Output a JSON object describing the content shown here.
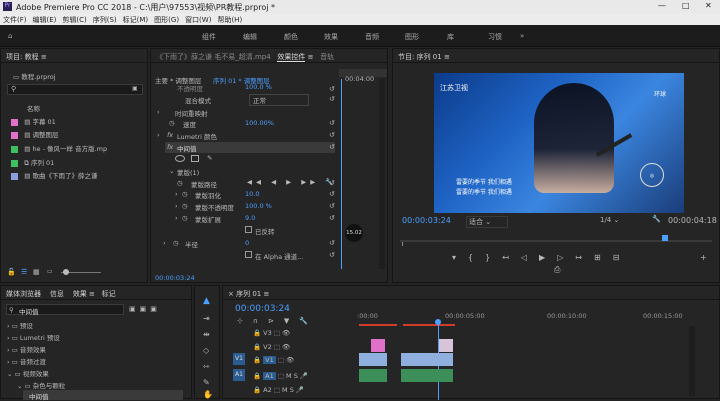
{
  "app_title": "Adobe Premiere Pro CC 2018 - C:\\用户\\97553\\视频\\PR教程.prproj *",
  "window_controls": [
    "—",
    "□",
    "✕"
  ],
  "menu": [
    "文件(F)",
    "编辑(E)",
    "剪辑(C)",
    "序列(S)",
    "标记(M)",
    "图形(G)",
    "窗口(W)",
    "帮助(H)"
  ],
  "workspaces": [
    "组件",
    "编辑",
    "颜色",
    "效果",
    "音频",
    "图形",
    "库",
    "习惯"
  ],
  "project": {
    "title": "项目: 教程",
    "file": "教程.prproj",
    "col_name": "名称",
    "items": [
      {
        "name": "字幕 01",
        "color": "#e070c8"
      },
      {
        "name": "调整图层",
        "color": "#e070c8"
      },
      {
        "name": "he - 像风一样 音方版.mp",
        "color": "#3fbf5f"
      },
      {
        "name": "序列 01",
        "color": "#3fbf5f"
      },
      {
        "name": "歌曲《下雨了》薛之谦",
        "color": "#8a9fe0"
      }
    ]
  },
  "effect_controls": {
    "tabs": [
      "《下雨了》薛之谦 毛不易_超清.mp4",
      "效果控件",
      "音轨"
    ],
    "master": "主要 * 调整图层",
    "seq": "序列 01 * 调整图层",
    "timecode": "00:04:00",
    "rows": {
      "blend_label": "混合模式",
      "blend_val": "正常",
      "opacity_partial": "不透明度",
      "opacity_val": "100.0 %",
      "time_remap": "时间重映射",
      "speed_label": "速度",
      "speed_val": "100.00%",
      "lumetri": "Lumetri 颜色",
      "median": "中间值",
      "mask": "蒙版(1)",
      "mask_path": "蒙版路径",
      "mask_feather": "蒙版羽化",
      "feather_val": "10.0",
      "mask_opacity": "蒙版不透明度",
      "mask_opacity_val": "100.0 %",
      "mask_expand": "蒙版扩展",
      "expand_val": "9.0",
      "invert": "已反转",
      "radius": "半径",
      "radius_val": "0",
      "alpha": "在 Alpha 通道...",
      "footer_tc": "00:00:03:24",
      "tooltip": "15.02"
    }
  },
  "program": {
    "title": "节目: 序列 01",
    "tc": "00:00:03:24",
    "fit": "适合",
    "quality": "1/4",
    "duration": "00:00:04:18",
    "logo": "江苏卫视",
    "subtitle1": "雷要的季节 我们相遇",
    "subtitle2": "雷要的季节 我们相遇",
    "badge": "环球"
  },
  "effects": {
    "tabs": [
      "媒体浏览器",
      "信息",
      "效果",
      "标记"
    ],
    "search": "中间值",
    "tree": [
      "预设",
      "Lumetri 预设",
      "音频效果",
      "音频过渡",
      "视频效果",
      "杂色与颗粒",
      "中间值"
    ]
  },
  "timeline": {
    "title": "序列 01",
    "tc": "00:00:03:24",
    "ruler": [
      ":00:00",
      "00:00:05:00",
      "00:00:10:00",
      "00:00:15:00"
    ],
    "tracks": [
      {
        "name": "V3"
      },
      {
        "name": "V2"
      },
      {
        "name": "V1",
        "src": "V1"
      },
      {
        "name": "A1",
        "src": "A1"
      },
      {
        "name": "A2"
      }
    ]
  },
  "colors": {
    "accent": "#4c9ffe",
    "label_pink": "#e070c8",
    "label_green": "#3fbf5f",
    "label_lav": "#8a9fe0",
    "clip_blue": "#8fb0de",
    "timeline_red": "#d23a2a"
  }
}
